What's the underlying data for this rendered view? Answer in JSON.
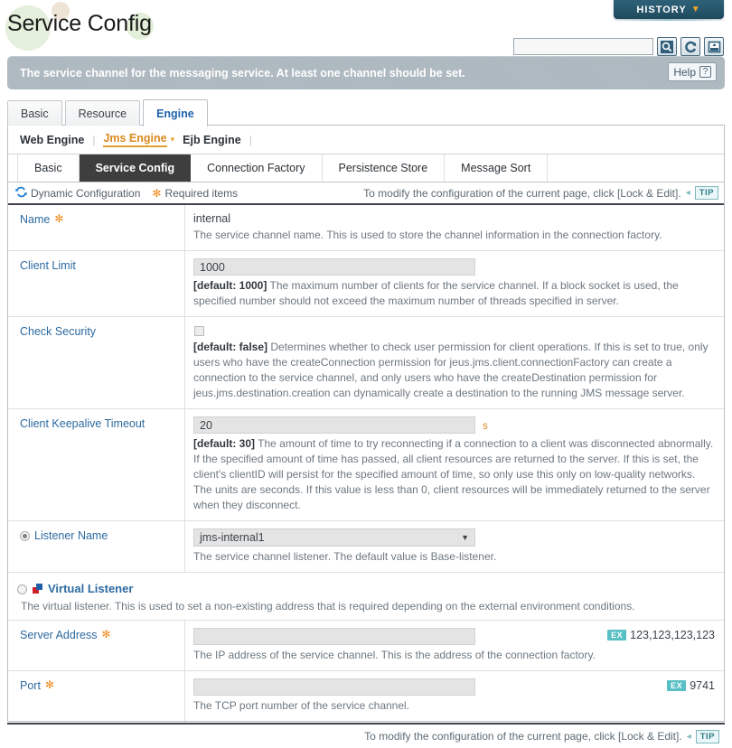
{
  "header": {
    "title": "Service Config",
    "history_label": "HISTORY",
    "history_caret": "▼",
    "search_placeholder": "",
    "search_value": "",
    "icons": {
      "search": "search-icon",
      "refresh": "refresh-icon",
      "xml": "xml-export-icon"
    }
  },
  "banner": {
    "message": "The service channel for the messaging service. At least one channel should be set.",
    "help_label": "Help",
    "help_mark": "?"
  },
  "tabs1": [
    {
      "label": "Basic",
      "active": false
    },
    {
      "label": "Resource",
      "active": false
    },
    {
      "label": "Engine",
      "active": true
    }
  ],
  "engines": [
    {
      "label": "Web Engine",
      "current": false
    },
    {
      "label": "Jms Engine",
      "current": true
    },
    {
      "label": "Ejb Engine",
      "current": false
    }
  ],
  "engine_caret": "▾",
  "engine_sep": "|",
  "tabs2": [
    {
      "label": "Basic",
      "active": false
    },
    {
      "label": "Service Config",
      "active": true
    },
    {
      "label": "Connection Factory",
      "active": false
    },
    {
      "label": "Persistence Store",
      "active": false
    },
    {
      "label": "Message Sort",
      "active": false
    }
  ],
  "legend": {
    "dynamic_config": "Dynamic Configuration",
    "required_items": "Required items",
    "required_mark": "✻",
    "hint": "To modify the configuration of the current page, click [Lock & Edit].",
    "tip": "TIP"
  },
  "fields": {
    "name": {
      "label": "Name",
      "required": true,
      "value": "internal",
      "desc": "The service channel name. This is used to store the channel information in the connection factory."
    },
    "client_limit": {
      "label": "Client Limit",
      "value": "1000",
      "default_tag": "[default: 1000]",
      "desc": "The maximum number of clients for the service channel. If a block socket is used, the specified number should not exceed the maximum number of threads specified in server."
    },
    "check_security": {
      "label": "Check Security",
      "checked": false,
      "default_tag": "[default: false]",
      "desc": "Determines whether to check user permission for client operations. If this is set to true, only users who have the createConnection permission for jeus.jms.client.connectionFactory can create a connection to the service channel, and only users who have the createDestination permission for jeus.jms.destination.creation can dynamically create a destination to the running JMS message server."
    },
    "client_keepalive_timeout": {
      "label": "Client Keepalive Timeout",
      "value": "20",
      "unit": "s",
      "default_tag": "[default: 30]",
      "desc": "The amount of time to try reconnecting if a connection to a client was disconnected abnormally. If the specified amount of time has passed, all client resources are returned to the server. If this is set, the client's clientID will persist for the specified amount of time, so only use this only on low-quality networks. The units are seconds. If this value is less than 0, client resources will be immediately returned to the server when they disconnect."
    },
    "listener_name": {
      "label": "Listener Name",
      "selected": true,
      "value": "jms-internal1",
      "caret": "▼",
      "desc": "The service channel listener. The default value is Base-listener."
    },
    "virtual_listener": {
      "label": "Virtual Listener",
      "selected": false,
      "desc": "The virtual listener. This is used to set a non-existing address that is required depending on the external environment conditions."
    },
    "server_address": {
      "label": "Server Address",
      "required": true,
      "value": "",
      "example_badge": "EX",
      "example_value": "123,123,123,123",
      "desc": "The IP address of the service channel. This is the address of the connection factory."
    },
    "port": {
      "label": "Port",
      "required": true,
      "value": "",
      "example_badge": "EX",
      "example_value": "9741",
      "desc": "The TCP port number of the service channel."
    }
  },
  "footer": {
    "hint": "To modify the configuration of the current page, click [Lock & Edit].",
    "tip": "TIP"
  }
}
